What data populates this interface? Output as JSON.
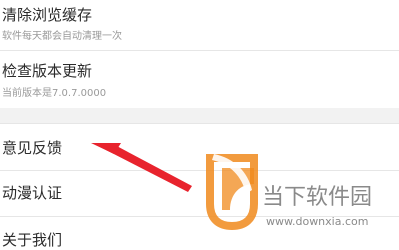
{
  "settings": {
    "clear_cache": {
      "title": "清除浏览缓存",
      "subtitle": "软件每天都会自动清理一次"
    },
    "check_update": {
      "title": "检查版本更新",
      "subtitle": "当前版本是7.0.7.0000"
    },
    "feedback": {
      "title": "意见反馈"
    },
    "anime_auth": {
      "title": "动漫认证"
    },
    "about": {
      "title": "关于我们"
    }
  },
  "watermark": {
    "name": "当下软件园",
    "url": "www.downxia.com"
  },
  "colors": {
    "arrow": "#e8232d",
    "logo_orange": "#f08a1c",
    "divider": "#e6e6e6",
    "section_gap": "#f2f2f2",
    "subtitle": "#9a9a9a"
  }
}
